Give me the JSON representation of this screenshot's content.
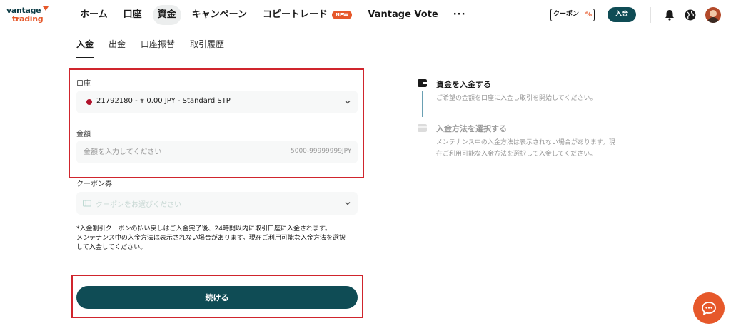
{
  "brand": {
    "line1": "vantage",
    "line2": "trading"
  },
  "nav": [
    {
      "label": "ホーム",
      "active": false
    },
    {
      "label": "口座",
      "active": false
    },
    {
      "label": "資金",
      "active": true
    },
    {
      "label": "キャンペーン",
      "active": false
    },
    {
      "label": "コピートレード",
      "active": false,
      "badge": "NEW"
    },
    {
      "label": "Vantage Vote",
      "active": false
    }
  ],
  "nav_more": "···",
  "header_actions": {
    "coupon_label": "クーポン",
    "coupon_badge": "%",
    "deposit_label": "入金"
  },
  "tabs": [
    "入金",
    "出金",
    "口座振替",
    "取引履歴"
  ],
  "form": {
    "account_label": "口座",
    "account_value": "21792180 - ¥ 0.00 JPY - Standard STP",
    "amount_label": "金額",
    "amount_placeholder": "金額を入力してください",
    "amount_range": "5000-99999999",
    "amount_unit": "JPY",
    "coupon_label": "クーポン券",
    "coupon_placeholder": "クーポンをお選びください",
    "note_line1": "*入金割引クーポンの払い戻しはご入金完了後、24時間以内に取引口座に入金されます。",
    "note_line2": "メンテナンス中の入金方法は表示されない場合があります。現在ご利用可能な入金方法を選択",
    "note_line3": "して入金してください。",
    "submit_label": "続ける"
  },
  "steps": [
    {
      "title": "資金を入金する",
      "desc": "ご希望の金額を口座に入金し取引を開始してください。",
      "active": true
    },
    {
      "title": "入金方法を選択する",
      "desc_line1": "メンテナンス中の入金方法は表示されない場合があります。現",
      "desc_line2": "在ご利用可能な入金方法を選択して入金してください。",
      "active": false
    }
  ],
  "colors": {
    "primary": "#0f4c55",
    "accent": "#e6582a",
    "highlight": "#d0252d",
    "account_dot": "#b0132c"
  },
  "icons": [
    "bell-icon",
    "globe-icon",
    "chevron-down-icon",
    "coupon-ticket-icon",
    "wallet-icon",
    "card-icon",
    "chat-icon"
  ]
}
